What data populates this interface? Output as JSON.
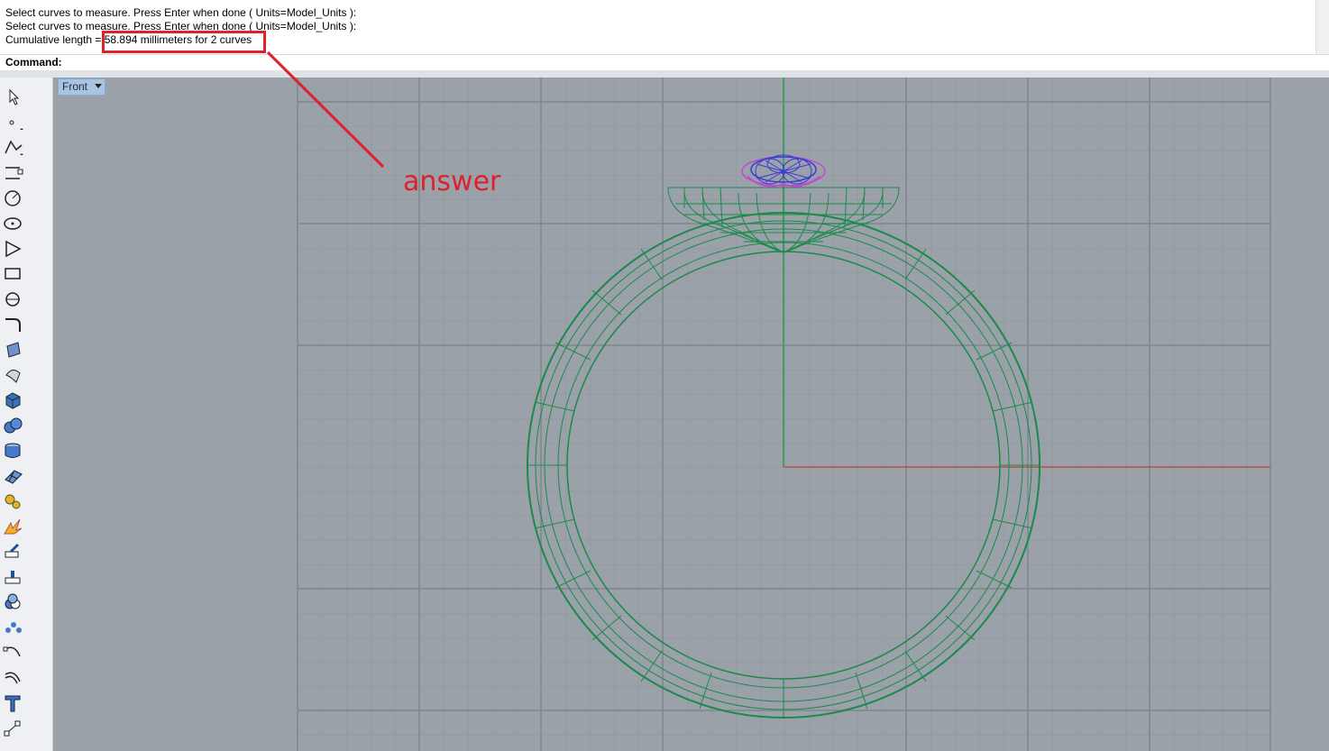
{
  "command_history": {
    "lines": [
      "Select curves to measure. Press Enter when done ( Units=Model_Units ):",
      "Select curves to measure. Press Enter when done ( Units=Model_Units ):",
      "Cumulative length = 58.894 millimeters for 2 curves"
    ]
  },
  "command_prompt": {
    "label": "Command:"
  },
  "viewport": {
    "name": "Front",
    "grid_color": "#8b9299",
    "background": "#9aa1a8",
    "x_axis_color": "#b45050",
    "y_axis_color": "#2e9a4a",
    "ring_color": "#1a8a4a",
    "gem_colors": [
      "#3a3ad6",
      "#c04ad0"
    ]
  },
  "toolbar": {
    "tools": [
      "select-arrow-icon",
      "point-icon",
      "polyline-icon",
      "curve-icon",
      "circle-icon",
      "ellipse-icon",
      "polygon-icon",
      "rectangle-icon",
      "arc-icon",
      "fillet-curve-icon",
      "surface-corner-icon",
      "extrude-surface-icon",
      "box-solid-icon",
      "sphere-solid-icon",
      "cylinder-solid-icon",
      "mesh-plane-icon",
      "transform-gears-icon",
      "explode-icon",
      "split-icon",
      "trim-icon",
      "boolean-icon",
      "array-icon",
      "rebuild-curve-icon",
      "offset-curve-icon",
      "text-icon",
      "dimension-icon"
    ]
  },
  "annotation": {
    "label": "answer",
    "color": "#e0202a"
  }
}
